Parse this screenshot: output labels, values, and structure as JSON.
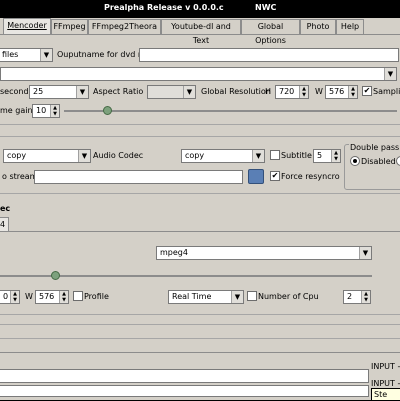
{
  "window": {
    "title": "Prealpha Release v 0.0.0.c",
    "subtitle": "NWC"
  },
  "tabs": [
    {
      "label": "Mencoder",
      "active": true
    },
    {
      "label": "FFmpeg",
      "active": false
    },
    {
      "label": "FFmpeg2Theora",
      "active": false
    },
    {
      "label": "Youtube-dl and Text",
      "active": false
    },
    {
      "label": "Global Options",
      "active": false
    },
    {
      "label": "Photo",
      "active": false
    },
    {
      "label": "Help",
      "active": false
    }
  ],
  "row1": {
    "files_combo": "files",
    "outputname_label": "Ouputname for dvd rip"
  },
  "row3": {
    "fps_label": "second",
    "fps_value": "25",
    "aspect_label": "Aspect Ratio",
    "aspect_value": "",
    "global_res_label": "Global Resolution",
    "h_label": "H",
    "h_value": "720",
    "w_label": "W",
    "w_value": "576",
    "sampling_label": "Samplin"
  },
  "row4": {
    "gain_label": "me gain",
    "gain_value": "10"
  },
  "audio": {
    "video_codec_value": "copy",
    "audio_codec_label": "Audio Codec",
    "audio_codec_value": "copy",
    "subtitle_label": "Subtitle",
    "subtitle_value": "5",
    "stream_label": "o stream",
    "force_resync_label": "Force resyncro",
    "double_pass_label": "Double pass",
    "disabled_label": "Disabled"
  },
  "section": {
    "codec_heading": "ec",
    "subtab_label": "4"
  },
  "video": {
    "codec_value": "mpeg4",
    "w_label": "W",
    "w_value": "576",
    "h_value": "0",
    "profile_label": "Profile",
    "preset_value": "Real Time",
    "cpu_label": "Number of Cpu",
    "cpu_value": "2"
  },
  "bottom": {
    "input_label_1": "INPUT -c",
    "input_label_2": "INPUT -c",
    "status_text": "Ste"
  }
}
